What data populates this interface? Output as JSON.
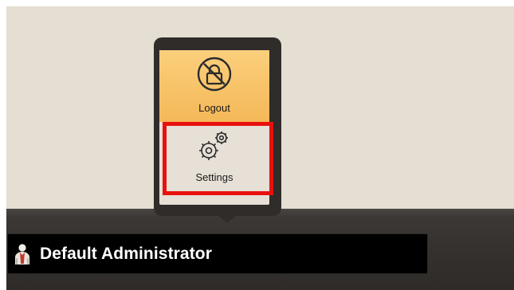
{
  "popup_menu": {
    "items": [
      {
        "label": "Logout",
        "icon": "logout-lock-icon"
      },
      {
        "label": "Settings",
        "icon": "gears-icon"
      }
    ]
  },
  "user_bar": {
    "icon": "user-person-icon",
    "name": "Default Administrator"
  },
  "colors": {
    "desktop_bg": "#e4ded3",
    "taskbar": "#33302d",
    "logout_highlight": "#f7c46a",
    "annotation_box": "#e8110f"
  }
}
